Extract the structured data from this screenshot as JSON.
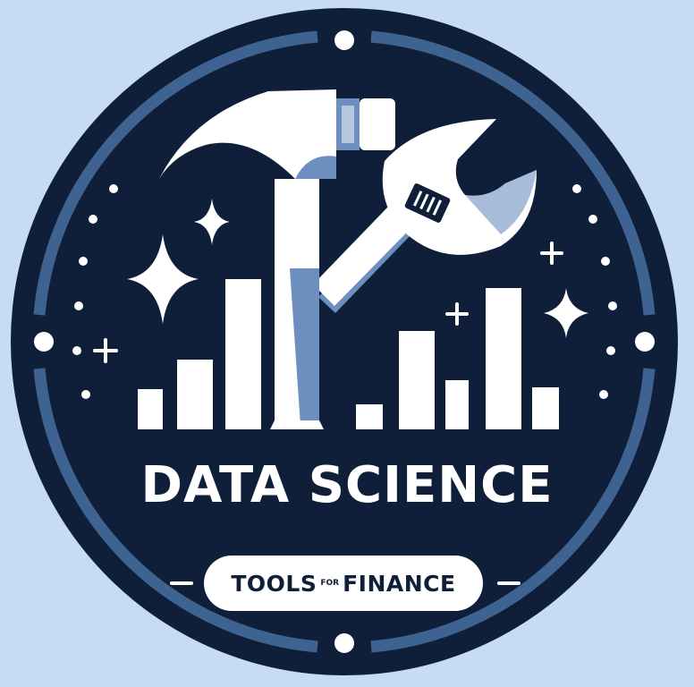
{
  "badge": {
    "title": "DATA SCIENCE",
    "subtitle_left": "TOOLS",
    "subtitle_mid": "FOR",
    "subtitle_right": "FINANCE"
  },
  "colors": {
    "background": "#c6dcf5",
    "circle": "#0f1f3a",
    "ring": "#3f6390",
    "accent": "#6d8fbf",
    "white": "#ffffff"
  },
  "icons": [
    "hammer-icon",
    "wrench-icon",
    "bar-chart-icon",
    "sparkle-icon"
  ]
}
